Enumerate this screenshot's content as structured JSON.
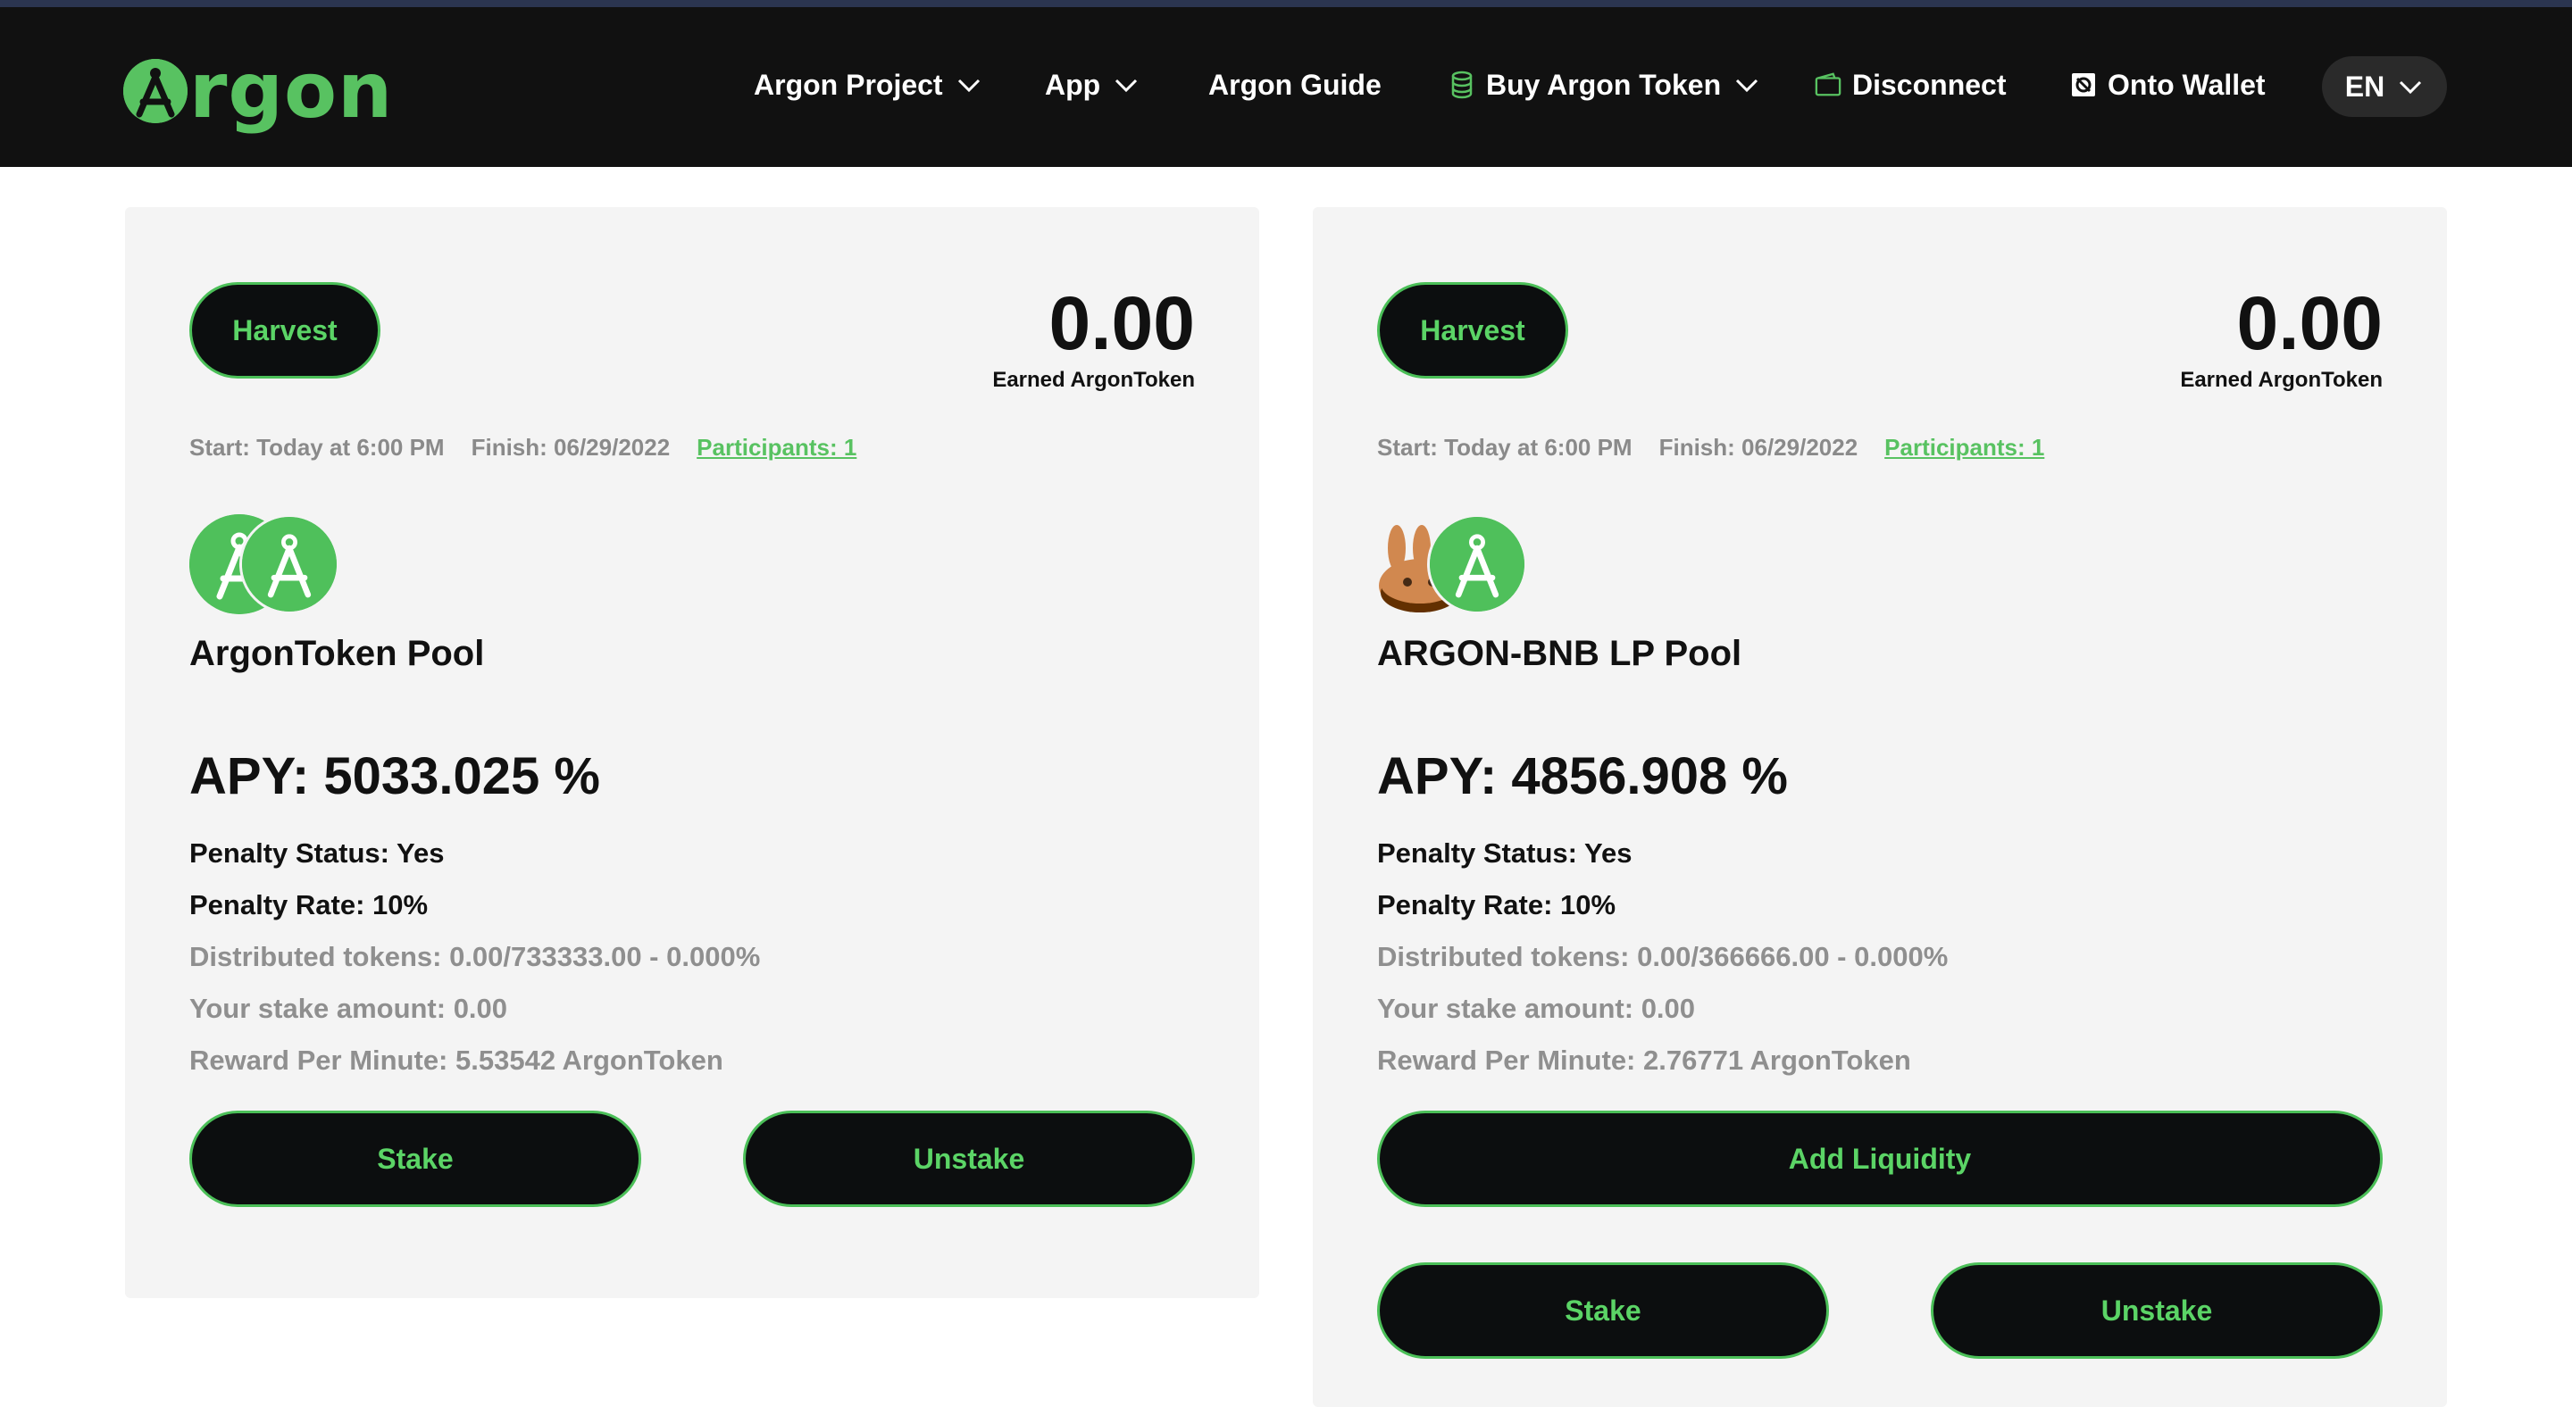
{
  "brand": {
    "logo_text": "rgon",
    "color": "#58c261"
  },
  "nav": {
    "items": [
      {
        "label": "Argon Project",
        "icon": "chevron-down-icon"
      },
      {
        "label": "App",
        "icon": "chevron-down-icon"
      },
      {
        "label": "Argon Guide"
      },
      {
        "label": "Buy Argon Token",
        "icon": "coins-stack-icon"
      },
      {
        "label": "Disconnect",
        "icon": "wallet-icon"
      },
      {
        "label": "Onto Wallet",
        "icon": "onto-wallet-icon"
      }
    ],
    "language": "EN"
  },
  "pools": [
    {
      "harvest_label": "Harvest",
      "earned_value": "0.00",
      "earned_label": "Earned ArgonToken",
      "start": "Start: Today at 6:00 PM",
      "finish": "Finish: 06/29/2022",
      "participants": "Participants: 1",
      "name": "ArgonToken Pool",
      "apy": "APY: 5033.025 %",
      "penalty_status": "Penalty Status: Yes",
      "penalty_rate": "Penalty Rate: 10%",
      "distributed": "Distributed tokens: 0.00/733333.00 - 0.000%",
      "stake_amount": "Your stake amount: 0.00",
      "reward_per_minute": "Reward Per Minute: 5.53542 ArgonToken",
      "stake_label": "Stake",
      "unstake_label": "Unstake"
    },
    {
      "harvest_label": "Harvest",
      "earned_value": "0.00",
      "earned_label": "Earned ArgonToken",
      "start": "Start: Today at 6:00 PM",
      "finish": "Finish: 06/29/2022",
      "participants": "Participants: 1",
      "name": "ARGON-BNB LP Pool",
      "apy": "APY: 4856.908 %",
      "penalty_status": "Penalty Status: Yes",
      "penalty_rate": "Penalty Rate: 10%",
      "distributed": "Distributed tokens: 0.00/366666.00 - 0.000%",
      "stake_amount": "Your stake amount: 0.00",
      "reward_per_minute": "Reward Per Minute: 2.76771 ArgonToken",
      "add_liquidity_label": "Add Liquidity",
      "stake_label": "Stake",
      "unstake_label": "Unstake"
    }
  ],
  "colors": {
    "accent": "#58c261",
    "button_bg": "#0c0e0f",
    "card_bg": "#f4f4f4",
    "navbar_bg": "#111111"
  }
}
